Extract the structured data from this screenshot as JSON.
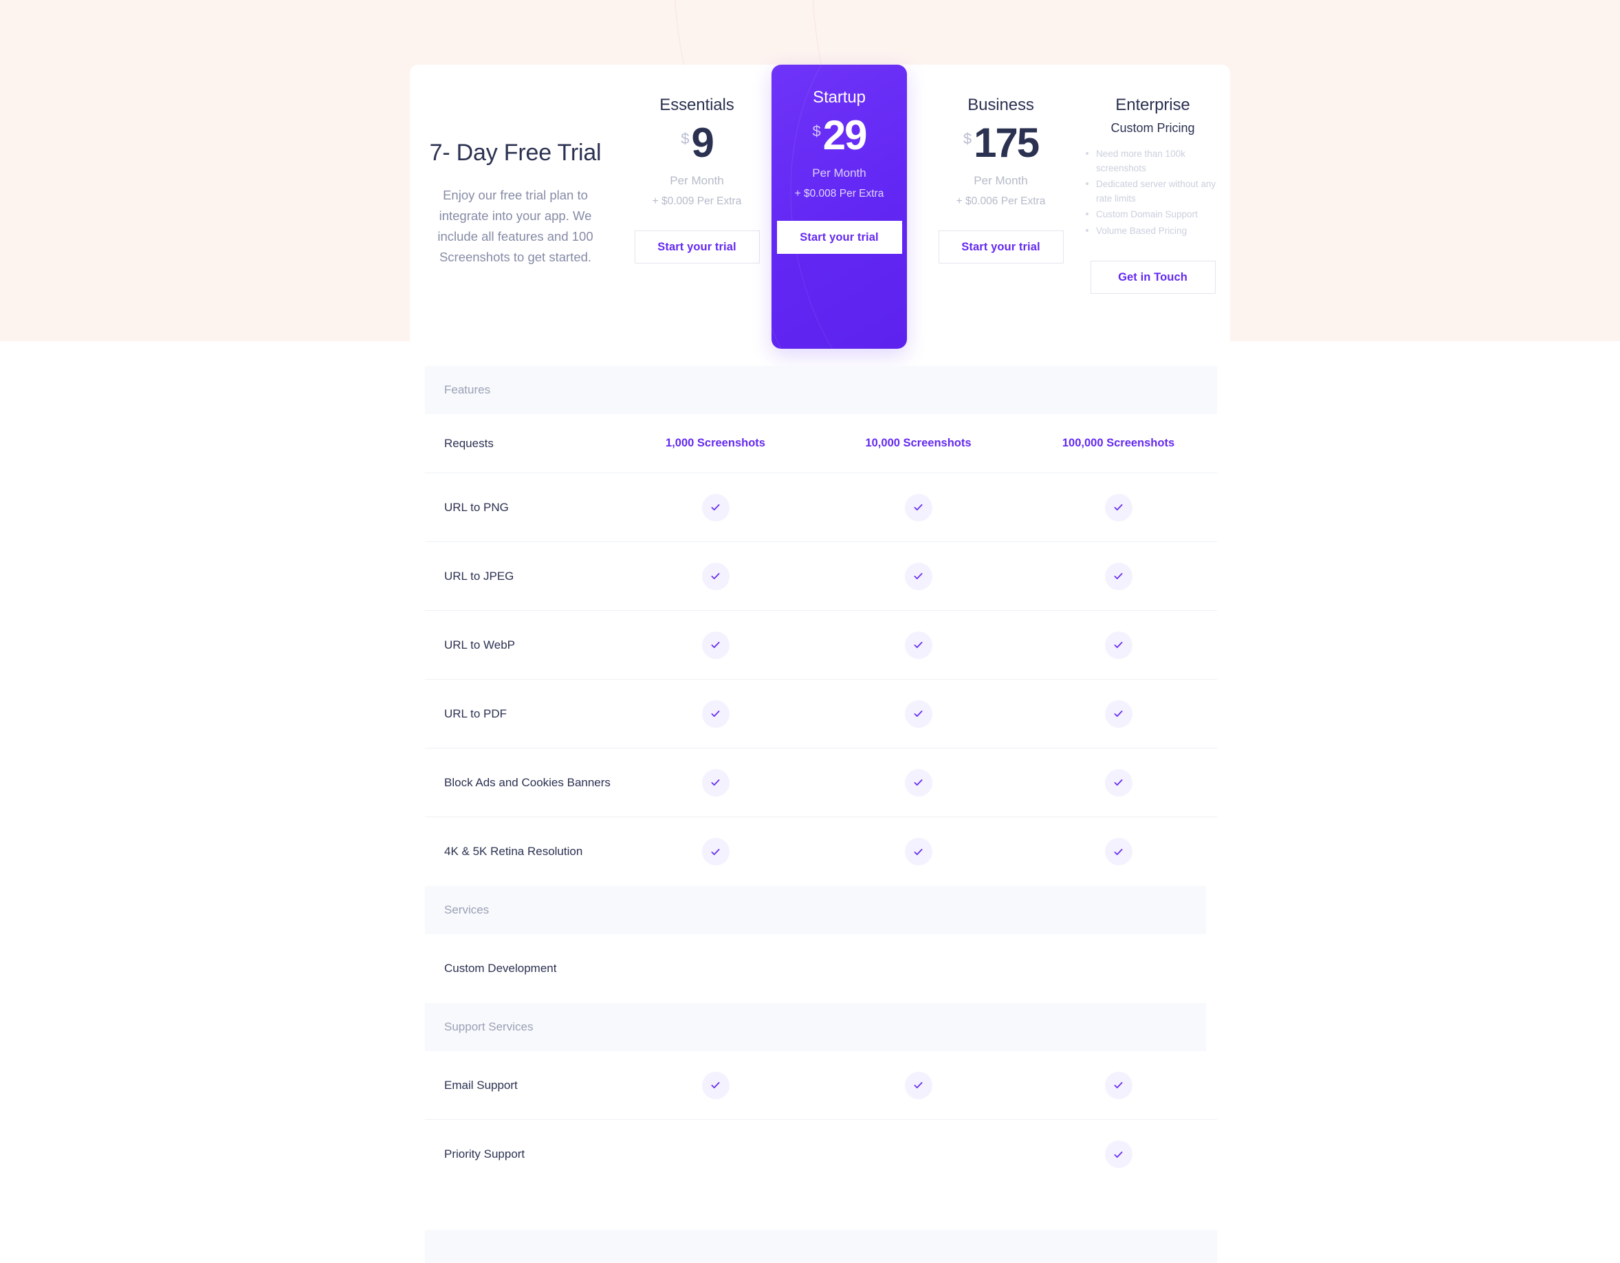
{
  "theme": {
    "accent": "#6429f0",
    "featured_bg": "#6227f3",
    "hero_bg": "#fdf3ef",
    "heading": "#2b3151",
    "muted": "#868ba6",
    "section_bg": "#f7f9fc"
  },
  "intro": {
    "title": "7- Day Free Trial",
    "description": "Enjoy our free trial plan to integrate into your app. We include all features and 100 Screenshots to get started."
  },
  "plans": [
    {
      "name": "Essentials",
      "currency": "$",
      "price": "9",
      "period": "Per Month",
      "extra": "+ $0.009 Per Extra",
      "cta": "Start your trial",
      "featured": false
    },
    {
      "name": "Startup",
      "currency": "$",
      "price": "29",
      "period": "Per Month",
      "extra": "+ $0.008 Per Extra",
      "cta": "Start your trial",
      "featured": true
    },
    {
      "name": "Business",
      "currency": "$",
      "price": "175",
      "period": "Per Month",
      "extra": "+ $0.006 Per Extra",
      "cta": "Start your trial",
      "featured": false
    }
  ],
  "enterprise": {
    "name": "Enterprise",
    "subtitle": "Custom Pricing",
    "bullets": [
      "Need more than 100k screenshots",
      "Dedicated server without any rate limits",
      "Custom Domain Support",
      "Volume Based Pricing"
    ],
    "cta": "Get in Touch"
  },
  "sections": {
    "features": "Features",
    "services": "Services",
    "support_services": "Support Services"
  },
  "requests": {
    "label": "Requests",
    "values": [
      "1,000 Screenshots",
      "10,000 Screenshots",
      "100,000 Screenshots"
    ]
  },
  "feature_rows": [
    {
      "label": "URL to PNG",
      "checks": [
        true,
        true,
        true
      ]
    },
    {
      "label": "URL to JPEG",
      "checks": [
        true,
        true,
        true
      ]
    },
    {
      "label": "URL to WebP",
      "checks": [
        true,
        true,
        true
      ]
    },
    {
      "label": "URL to PDF",
      "checks": [
        true,
        true,
        true
      ]
    },
    {
      "label": "Block Ads and Cookies Banners",
      "checks": [
        true,
        true,
        true
      ]
    },
    {
      "label": "4K & 5K Retina Resolution",
      "checks": [
        true,
        true,
        true
      ]
    }
  ],
  "service_rows": [
    {
      "label": "Custom Development",
      "checks": [
        false,
        false,
        false
      ]
    }
  ],
  "support_rows": [
    {
      "label": "Email Support",
      "checks": [
        true,
        true,
        true
      ]
    },
    {
      "label": "Priority Support",
      "checks": [
        false,
        false,
        true
      ]
    }
  ]
}
